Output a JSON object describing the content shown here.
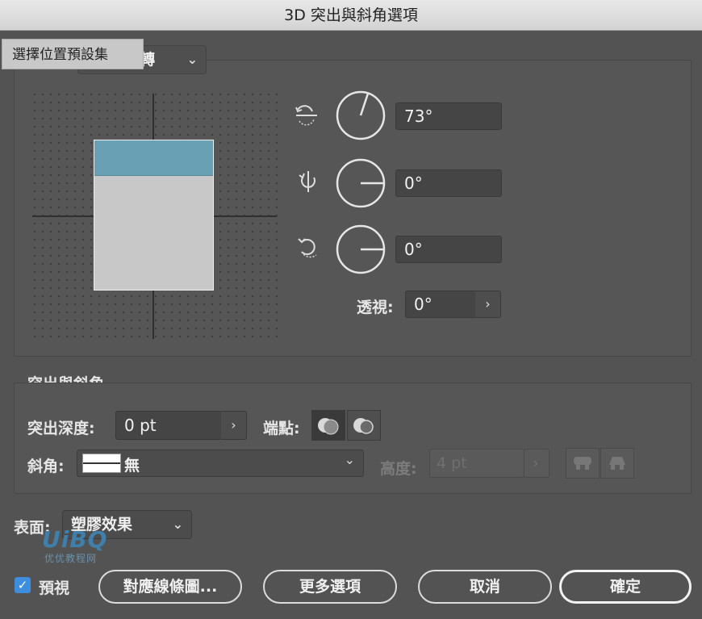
{
  "window": {
    "title": "3D 突出與斜角選項"
  },
  "tooltip": {
    "text": "選擇位置預設集"
  },
  "position": {
    "preset_select_value": "轉",
    "rotations": [
      {
        "value": "73°",
        "angle_deg": 73
      },
      {
        "value": "0°",
        "angle_deg": 0
      },
      {
        "value": "0°",
        "angle_deg": 0
      }
    ],
    "perspective_label": "透視:",
    "perspective_value": "0°"
  },
  "extrude": {
    "section_title": "突出與斜角",
    "depth_label": "突出深度:",
    "depth_value": "0 pt",
    "cap_label": "端點:",
    "bevel_label": "斜角:",
    "bevel_value": "無",
    "height_label": "高度:",
    "height_value": "4 pt"
  },
  "surface": {
    "label": "表面:",
    "value": "塑膠效果"
  },
  "watermark": {
    "logo": "UiBQ",
    "text": "优优教程网"
  },
  "footer": {
    "preview_label": "預視",
    "preview_checked": true,
    "map_art_button": "對應線條圖...",
    "more_options_button": "更多選項",
    "cancel_button": "取消",
    "ok_button": "確定"
  },
  "colors": {
    "cube_face": "#c8c8c8",
    "cube_top": "#6aa0b4",
    "checkbox": "#3e8ee0"
  }
}
